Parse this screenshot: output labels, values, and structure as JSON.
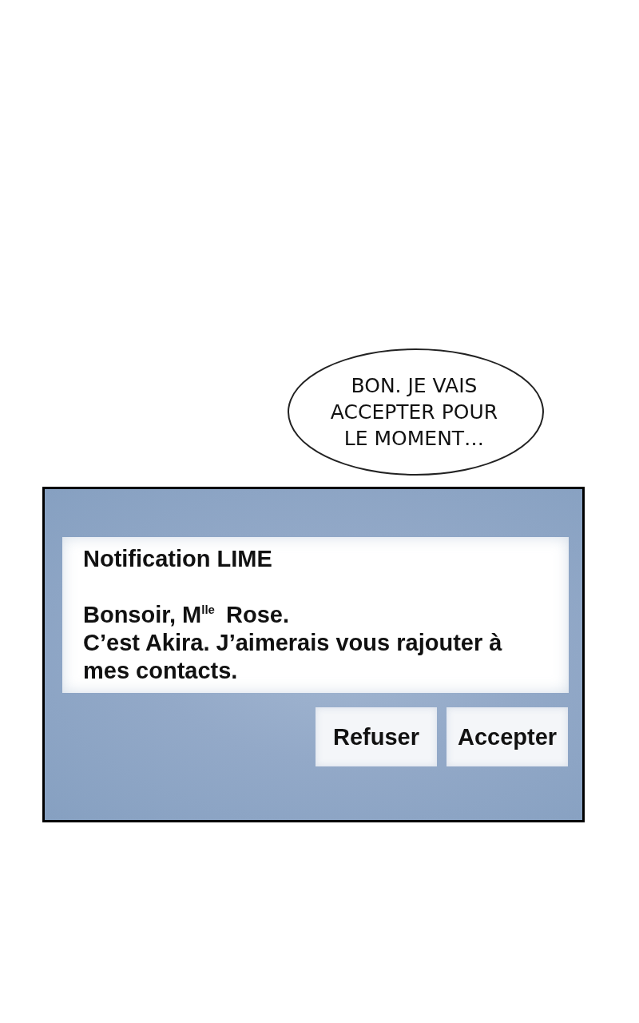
{
  "speech_bubble": {
    "text": "BON. JE VAIS ACCEPTER POUR LE MOMENT…"
  },
  "notification": {
    "title": "Notification LIME",
    "message_lines": [
      "Bonsoir, M$^{lle}$ Rose.",
      "C’est Akira. J’aimerais vous rajouter à mes contacts."
    ],
    "buttons": [
      {
        "label": "Refuser"
      },
      {
        "label": "Accepter"
      }
    ]
  }
}
